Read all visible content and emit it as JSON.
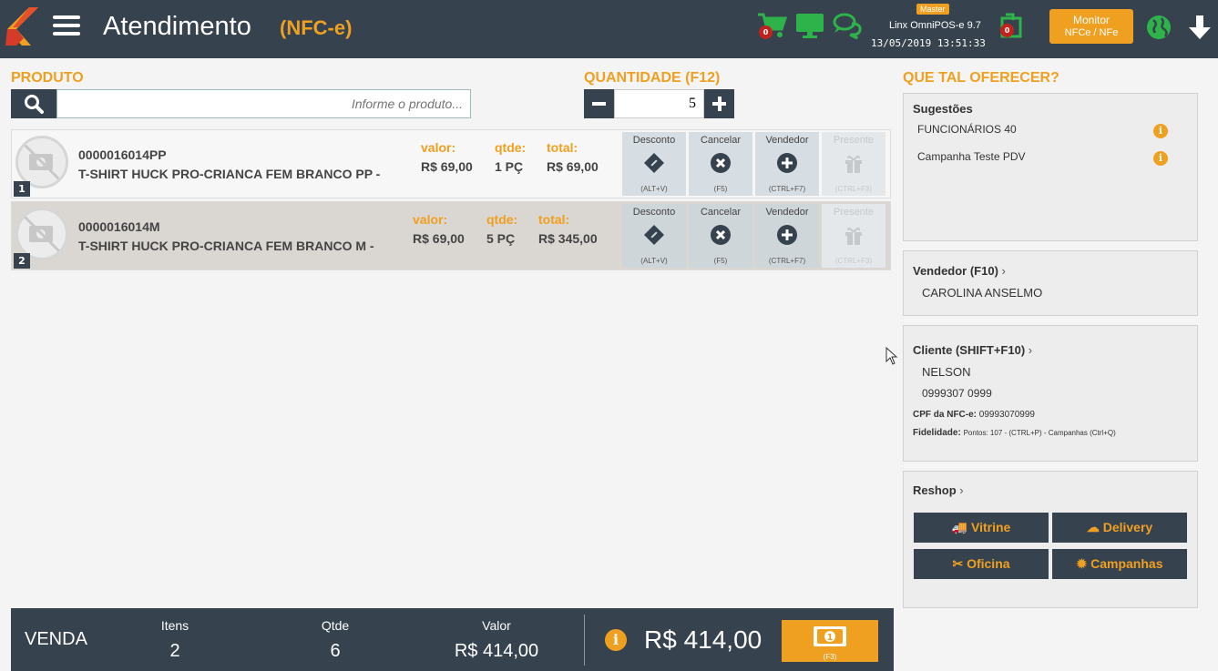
{
  "header": {
    "title": "Atendimento",
    "subtitle": "(NFC-e)",
    "cart_count": "0",
    "sync_count": "0",
    "master_label": "Master",
    "version": "Linx OmniPOS-e  9.7",
    "datetime": "13/05/2019 13:51:33",
    "monitor_line1": "Monitor",
    "monitor_line2": "NFCe / NFe"
  },
  "produto": {
    "label": "PRODUTO",
    "placeholder": "Informe o produto...",
    "quantity_label": "QUANTIDADE (F12)",
    "quantity_value": "5"
  },
  "items": [
    {
      "num": "1",
      "code": "0000016014PP",
      "desc": "T-SHIRT HUCK PRO-CRIANCA FEM BRANCO PP -",
      "valor_label": "valor:",
      "valor": "R$ 69,00",
      "qtde_label": "qtde:",
      "qtde": "1 PÇ",
      "total_label": "total:",
      "total": "R$ 69,00"
    },
    {
      "num": "2",
      "code": "0000016014M",
      "desc": "T-SHIRT HUCK PRO-CRIANCA FEM BRANCO M -",
      "valor_label": "valor:",
      "valor": "R$ 69,00",
      "qtde_label": "qtde:",
      "qtde": "5 PÇ",
      "total_label": "total:",
      "total": "R$ 345,00"
    }
  ],
  "actions": {
    "desconto": "Desconto",
    "desconto_key": "(ALT+V)",
    "cancelar": "Cancelar",
    "cancelar_key": "(F5)",
    "vendedor": "Vendedor",
    "vendedor_key": "(CTRL+F7)",
    "presente": "Presente",
    "presente_key": "(CTRL+F3)"
  },
  "right_panel": {
    "title": "QUE TAL OFERECER?",
    "sugestoes_title": "Sugestões",
    "sugestoes": [
      "FUNCIONÁRIOS 40",
      "Campanha Teste PDV"
    ],
    "vendedor_title": "Vendedor (F10)",
    "vendedor_name": "CAROLINA ANSELMO",
    "cliente_title": "Cliente (SHIFT+F10)",
    "cliente_name": "NELSON",
    "cliente_phone": "0999307 0999",
    "cpf_label": "CPF da NFC-e:",
    "cpf_value": "09993070999",
    "fidelidade_label": "Fidelidade:",
    "fidelidade_value": "Pontos: 107 - (CTRL+P) - Campanhas (Ctrl+Q)",
    "reshop_title": "Reshop",
    "reshop_buttons": [
      "Vitrine",
      "Delivery",
      "Oficina",
      "Campanhas"
    ]
  },
  "footer": {
    "venda": "VENDA",
    "itens_label": "Itens",
    "itens": "2",
    "qtde_label": "Qtde",
    "qtde": "6",
    "valor_label": "Valor",
    "valor": "R$ 414,00",
    "total": "R$ 414,00",
    "pay_key": "(F3)"
  },
  "colors": {
    "dark": "#36434f",
    "accent": "#f0a020",
    "green": "#2db34a",
    "badge": "#c0231d"
  },
  "icons": [
    "logo",
    "menu-icon",
    "cart-icon",
    "monitor-icon",
    "chat-icon",
    "sync-icon",
    "globe-icon",
    "arrow-down-icon",
    "search-icon",
    "no-photo-icon",
    "ticket-icon",
    "cancel-icon",
    "add-icon",
    "gift-icon",
    "info-icon",
    "truck-icon",
    "cloud-icon",
    "scissors-icon",
    "gear-icon",
    "money-icon"
  ]
}
